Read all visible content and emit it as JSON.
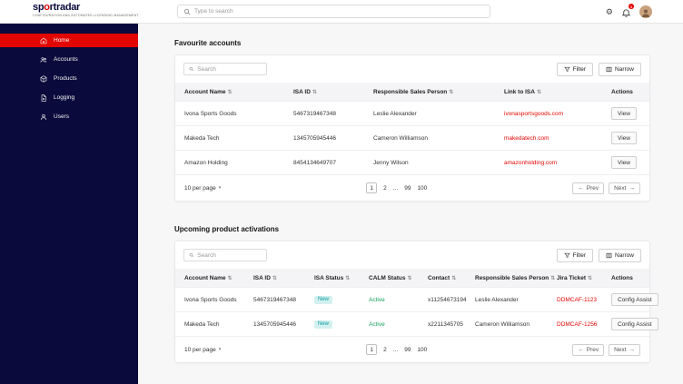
{
  "colors": {
    "accent_red": "#e10600",
    "sidebar_navy": "#0a0a3c",
    "badge_teal": "#0b9e9e",
    "status_green": "#17a35c"
  },
  "icons": {
    "sort": "⇅",
    "chevron_down": "▾",
    "arrow_left": "←",
    "arrow_right": "→",
    "theme": "⚙"
  },
  "brand": {
    "logo_prefix": "sp",
    "logo_o": "o",
    "logo_suffix": "rtradar",
    "tagline": "CONFIGURATION AND AUTOMATED LICENSING MANAGEMENT"
  },
  "header": {
    "search_placeholder": "Type to search",
    "notification_count": "5"
  },
  "sidebar": {
    "items": [
      {
        "label": "Home",
        "active": true
      },
      {
        "label": "Accounts",
        "active": false
      },
      {
        "label": "Products",
        "active": false
      },
      {
        "label": "Logging",
        "active": false
      },
      {
        "label": "Users",
        "active": false
      }
    ]
  },
  "favourites": {
    "title": "Favourite accounts",
    "search_placeholder": "Search",
    "filter_label": "Filter",
    "narrow_label": "Narrow",
    "columns": [
      "Account Name",
      "ISA ID",
      "Responsible Sales Person",
      "Link to ISA",
      "Actions"
    ],
    "rows": [
      {
        "name": "Ivona Sports Goods",
        "isa_id": "5467319467348",
        "sales": "Leslie Alexander",
        "link": "ivonasportsgoods.com",
        "action": "View"
      },
      {
        "name": "Makeda Tech",
        "isa_id": "1345705945446",
        "sales": "Cameron Williamson",
        "link": "makedatech.com",
        "action": "View"
      },
      {
        "name": "Amazon Holding",
        "isa_id": "8454134649707",
        "sales": "Jenny Wilson",
        "link": "amazonholding.com",
        "action": "View"
      }
    ],
    "pagination": {
      "per_page": "10 per page",
      "pages": [
        "1",
        "2",
        "...",
        "99",
        "100"
      ],
      "prev": "Prev",
      "next": "Next"
    }
  },
  "activations": {
    "title": "Upcoming product activations",
    "search_placeholder": "Search",
    "filter_label": "Filter",
    "narrow_label": "Narrow",
    "columns": [
      "Account Name",
      "ISA ID",
      "ISA Status",
      "CALM Status",
      "Contact",
      "Responsible Sales Person",
      "Jira Ticket",
      "Actions"
    ],
    "rows": [
      {
        "name": "Ivona Sports Goods",
        "isa_id": "5467319467348",
        "isa_status": "New",
        "calm_status": "Active",
        "contact": "x11254673194",
        "sales": "Leslie Alexander",
        "jira": "DDMCAF-1123",
        "action": "Config Assist"
      },
      {
        "name": "Makeda Tech",
        "isa_id": "1345705945446",
        "isa_status": "New",
        "calm_status": "Active",
        "contact": "x2211345705",
        "sales": "Cameron Williamson",
        "jira": "DDMCAF-1256",
        "action": "Config Assist"
      }
    ],
    "pagination": {
      "per_page": "10 per page",
      "pages": [
        "1",
        "2",
        "...",
        "99",
        "100"
      ],
      "prev": "Prev",
      "next": "Next"
    }
  }
}
